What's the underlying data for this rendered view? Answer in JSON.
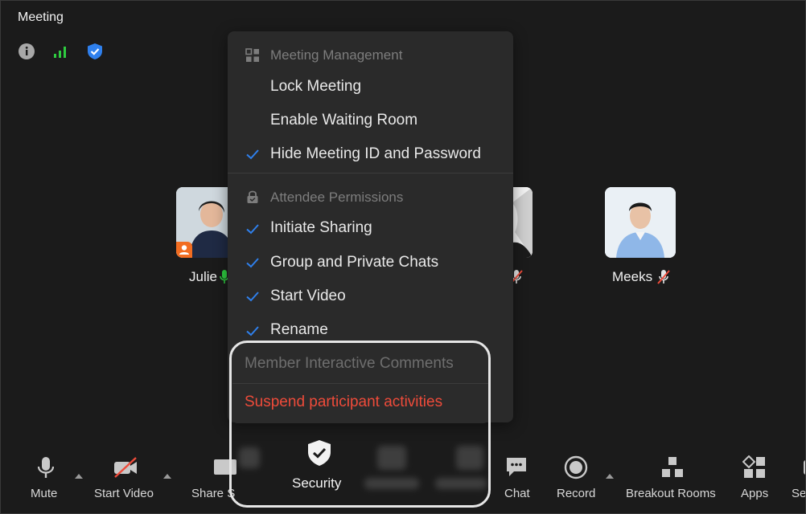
{
  "window": {
    "title": "Meeting"
  },
  "status_icons": [
    "info-icon",
    "signal-icon",
    "shield-icon"
  ],
  "participants": [
    {
      "name": "Julie",
      "mic": "on"
    },
    {
      "name": "Meeks",
      "mic": "muted"
    }
  ],
  "menu": {
    "section1_title": "Meeting Management",
    "items1": [
      {
        "label": "Lock Meeting",
        "checked": false
      },
      {
        "label": "Enable Waiting Room",
        "checked": false
      },
      {
        "label": "Hide Meeting ID and Password",
        "checked": true
      }
    ],
    "section2_title": "Attendee Permissions",
    "items2": [
      {
        "label": "Initiate Sharing",
        "checked": true
      },
      {
        "label": "Group and Private Chats",
        "checked": true
      },
      {
        "label": "Start Video",
        "checked": true
      },
      {
        "label": "Rename",
        "checked": true
      }
    ],
    "member_comments": "Member Interactive Comments",
    "suspend": "Suspend participant activities"
  },
  "toolbar": {
    "mute": "Mute",
    "start_video": "Start Video",
    "share": "Share S",
    "security": "Security",
    "chat": "Chat",
    "record": "Record",
    "breakout": "Breakout Rooms",
    "apps": "Apps",
    "settings": "Se"
  },
  "colors": {
    "accent": "#2f80ed",
    "danger": "#ee4b3a",
    "signal": "#2ecc40",
    "badge": "#f26d21"
  }
}
